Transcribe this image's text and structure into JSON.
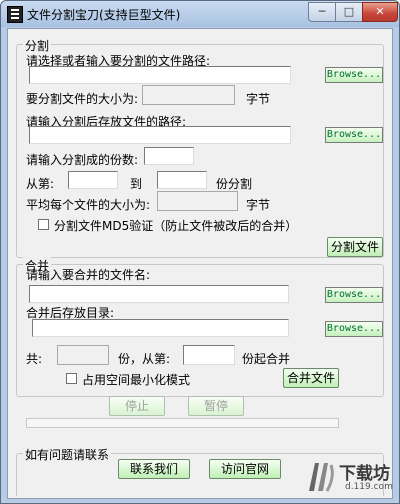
{
  "window": {
    "title": "文件分割宝刀(支持巨型文件)",
    "buttons": {
      "minimize": "─",
      "maximize": "□",
      "close": "✕"
    }
  },
  "split": {
    "legend": "分割",
    "source_label": "请选择或者输入要分割的文件路径:",
    "source_value": "",
    "browse1": "Browse...",
    "size_label": "要分割文件的大小为:",
    "size_value": "",
    "size_unit": "字节",
    "dest_label": "请输入分割后存放文件的路径:",
    "dest_value": "",
    "browse2": "Browse...",
    "parts_label": "请输入分割成的份数:",
    "parts_value": "",
    "from_label": "从第:",
    "from_value": "",
    "to_label": "到",
    "to_value": "",
    "part_split_label": "份分割",
    "avg_label": "平均每个文件的大小为:",
    "avg_value": "",
    "avg_unit": "字节",
    "md5_label": "分割文件MD5验证（防止文件被改后的合并）",
    "split_button": "分割文件"
  },
  "merge": {
    "legend": "合并",
    "source_label": "请输入要合并的文件名:",
    "source_value": "",
    "browse3": "Browse...",
    "dest_label": "合并后存放目录:",
    "dest_value": "",
    "browse4": "Browse...",
    "total_label": "共:",
    "total_value": "",
    "from_label": "份，从第:",
    "from_value": "",
    "start_label": "份起合并",
    "minimize_label": "占用空间最小化模式",
    "merge_button": "合并文件"
  },
  "controls": {
    "stop": "停止",
    "pause": "暂停"
  },
  "progress": {
    "value": 0
  },
  "contact": {
    "legend": "如有问题请联系",
    "contact_button": "联系我们",
    "site_button": "访问官网"
  },
  "watermark": {
    "text": "下载坊",
    "url": "d.119.com"
  }
}
